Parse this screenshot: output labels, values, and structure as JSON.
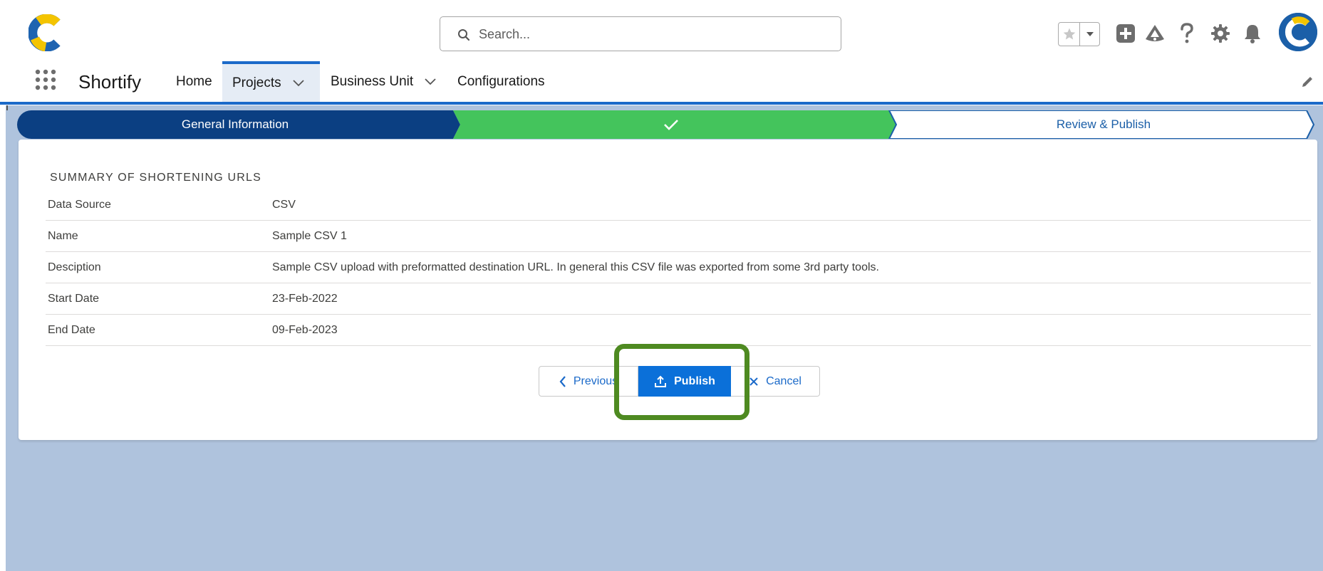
{
  "header": {
    "search_placeholder": "Search..."
  },
  "appnav": {
    "app_name": "Shortify",
    "tabs": [
      {
        "label": "Home"
      },
      {
        "label": "Projects"
      },
      {
        "label": "Business Unit"
      },
      {
        "label": "Configurations"
      }
    ]
  },
  "path": {
    "steps": [
      {
        "label": "General Information",
        "state": "current"
      },
      {
        "label": "",
        "state": "complete"
      },
      {
        "label": "Review & Publish",
        "state": "incomplete"
      }
    ]
  },
  "summary": {
    "title": "SUMMARY OF SHORTENING URLS",
    "rows": [
      {
        "label": "Data Source",
        "value": "CSV"
      },
      {
        "label": "Name",
        "value": "Sample CSV 1"
      },
      {
        "label": "Desciption",
        "value": "Sample CSV upload with preformatted destination URL. In general this CSV file was exported from some 3rd party tools."
      },
      {
        "label": "Start Date",
        "value": "23-Feb-2022"
      },
      {
        "label": "End Date",
        "value": "09-Feb-2023"
      }
    ]
  },
  "actions": {
    "previous": "Previous",
    "publish": "Publish",
    "cancel": "Cancel"
  },
  "colors": {
    "brand_blue": "#1b6ac9",
    "path_current": "#0b3f82",
    "path_complete": "#44c45c",
    "publish_button": "#0b70d9",
    "highlight": "#4e8a21",
    "page_bg": "#afc3dd"
  },
  "icons": {
    "logo": "c-logo-icon",
    "search": "search-icon",
    "favorite": "star-icon",
    "favorites_menu": "caret-down-icon",
    "global_actions": "plus-icon",
    "trailhead": "trailhead-icon",
    "help": "question-icon",
    "setup": "gear-icon",
    "notifications": "bell-icon",
    "app_launcher": "waffle-icon",
    "edit_nav": "pencil-icon"
  }
}
